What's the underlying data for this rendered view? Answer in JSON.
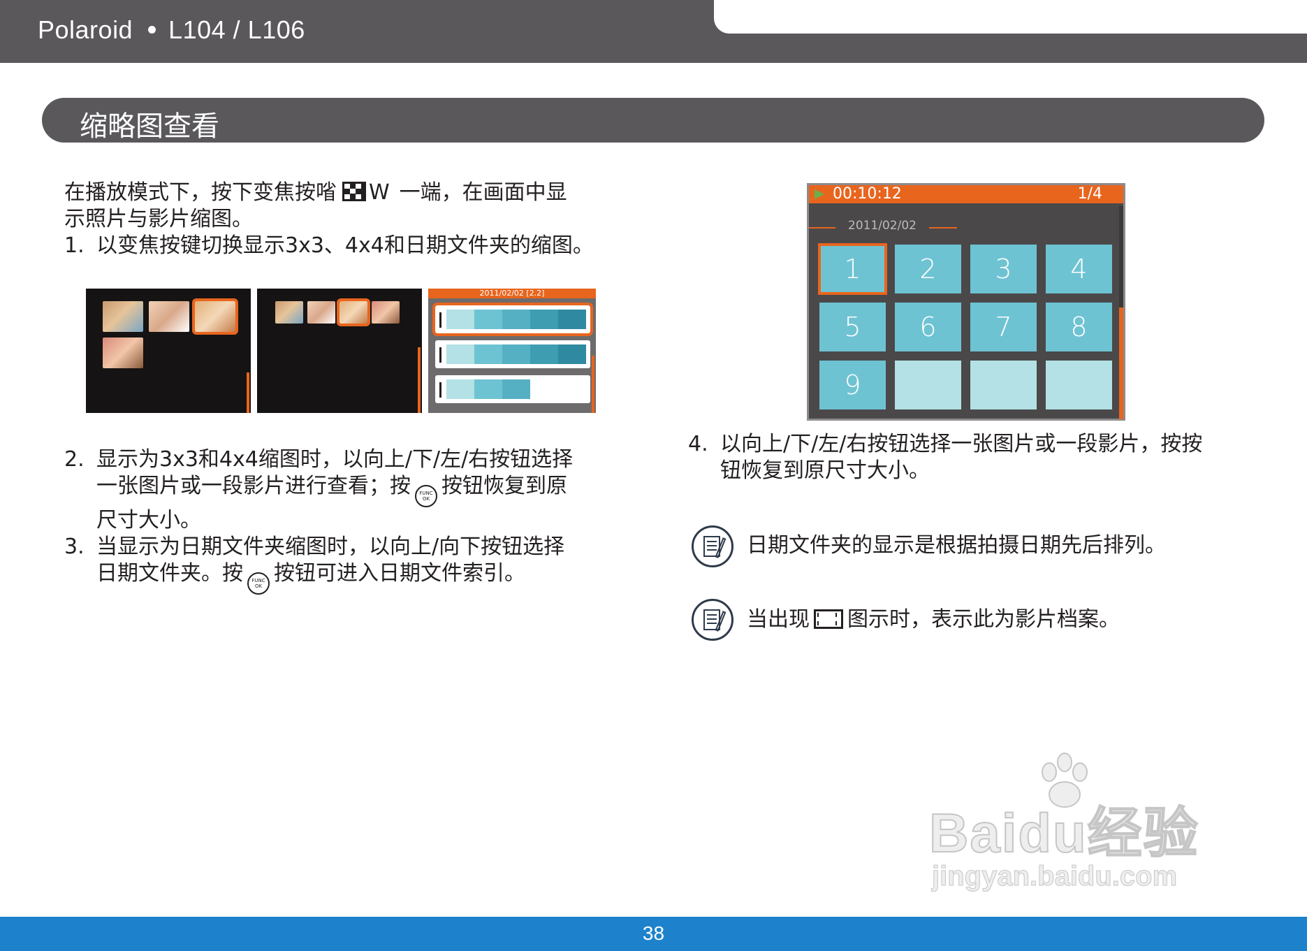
{
  "header": {
    "brand": "Polaroid",
    "model": "L104 / L106"
  },
  "section": {
    "title": "缩略图查看"
  },
  "intro": {
    "line1_before": "在播放模式下，按下变焦按㗂",
    "line1_key": "W",
    "line1_after": "一端，在画面中显",
    "line2": "示照片与影片缩图。"
  },
  "steps": [
    {
      "num": "1.",
      "lines": [
        "以变焦按键切换显示3x3、4x4和日期文件夹的缩图。"
      ]
    },
    {
      "num": "2.",
      "line1": "显示为3x3和4x4缩图时，以向上/下/左/右按钮选择",
      "line2_before": "一张图片或一段影片进行查看；按",
      "line2_after": "按钮恢复到原",
      "line3": "尺寸大小。"
    },
    {
      "num": "3.",
      "line1": "当显示为日期文件夹缩图时，以向上/向下按钮选择",
      "line2_before": "日期文件夹。按",
      "line2_after": "按钮可进入日期文件索引。"
    },
    {
      "num": "4.",
      "line1": "以向上/下/左/右按钮选择一张图片或一段影片，按按",
      "line2": "钮恢复到原尺寸大小。"
    }
  ],
  "func_button": {
    "top": "FUNC",
    "bottom": "OK"
  },
  "small_screens": {
    "folder_header": "2011/02/02  [2.2]"
  },
  "large_screen": {
    "time": "00:10:12",
    "count": "1/4",
    "date": "2011/02/02",
    "cells": [
      "1",
      "2",
      "3",
      "4",
      "5",
      "6",
      "7",
      "8",
      "9",
      "",
      "",
      ""
    ]
  },
  "notes": [
    {
      "text": "日期文件夹的显示是根据拍摄日期先后排列。"
    },
    {
      "before": "当出现",
      "after": "图示时，表示此为影片档案。"
    }
  ],
  "footer": {
    "page": "38"
  },
  "watermark": {
    "main": "Baidu经验",
    "sub": "jingyan.baidu.com"
  },
  "colors": {
    "header_gray": "#5a585b",
    "accent_orange": "#e8651e",
    "footer_blue": "#1d82cb",
    "cell_blue": "#6ec3d3"
  }
}
